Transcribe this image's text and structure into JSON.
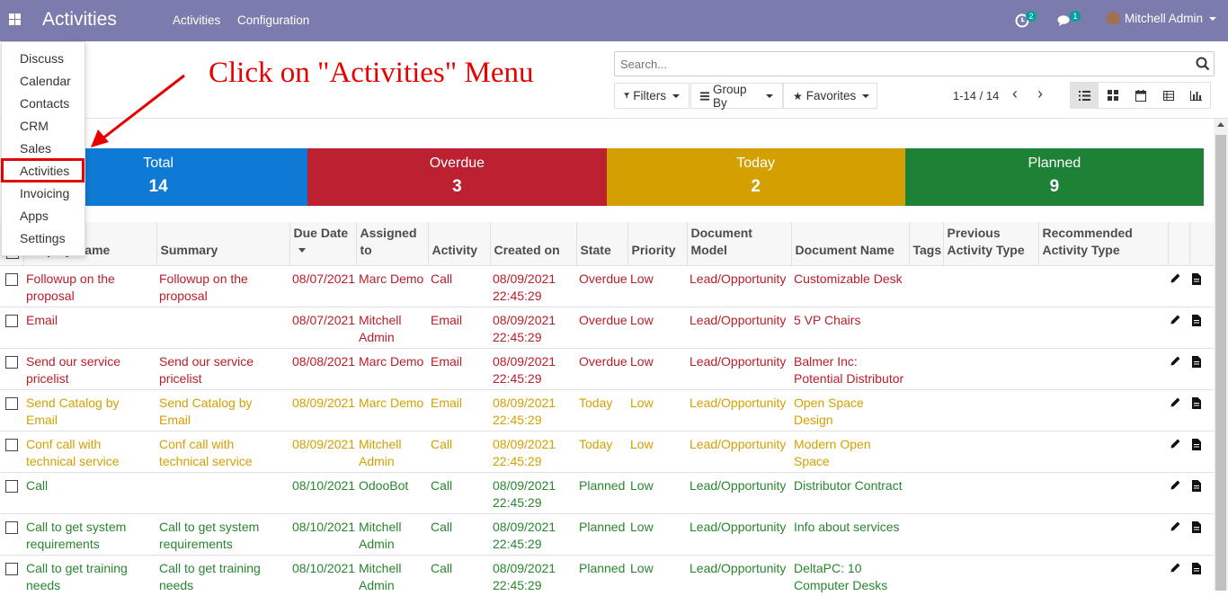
{
  "navbar": {
    "brand": "Activities",
    "menu": [
      "Activities",
      "Configuration"
    ],
    "activity_badge": "2",
    "message_badge": "1",
    "user_name": "Mitchell Admin",
    "bg_color": "#7c7bad"
  },
  "apps_menu": [
    "Discuss",
    "Calendar",
    "Contacts",
    "CRM",
    "Sales",
    "Activities",
    "Invoicing",
    "Apps",
    "Settings"
  ],
  "annotation": {
    "text": "Click on \"Activities\" Menu",
    "color": "#e60000"
  },
  "search": {
    "placeholder": "Search..."
  },
  "filters": {
    "filters": "Filters",
    "group_by": "Group By",
    "favorites": "Favorites"
  },
  "pager": {
    "value": "1-14 / 14"
  },
  "stats": [
    {
      "label": "Total",
      "value": "14",
      "color": "#0f7ad6"
    },
    {
      "label": "Overdue",
      "value": "3",
      "color": "#bb2130"
    },
    {
      "label": "Today",
      "value": "2",
      "color": "#d49f00"
    },
    {
      "label": "Planned",
      "value": "9",
      "color": "#1e8236"
    }
  ],
  "columns": {
    "display_name": "Display Name",
    "summary": "Summary",
    "due_date": "Due Date",
    "assigned_to": "Assigned to",
    "activity": "Activity",
    "created_on": "Created on",
    "state": "State",
    "priority": "Priority",
    "document_model": "Document Model",
    "document_name": "Document Name",
    "tags": "Tags",
    "previous_type": "Previous Activity Type",
    "recommended_type": "Recommended Activity Type"
  },
  "rows": [
    {
      "display_name": "Followup on the proposal",
      "summary": "Followup on the proposal",
      "due_date": "08/07/2021",
      "assigned_to": "Marc Demo",
      "activity": "Call",
      "created_on": "08/09/2021 22:45:29",
      "state": "Overdue",
      "priority": "Low",
      "document_model": "Lead/Opportunity",
      "document_name": "Customizable Desk",
      "status": "overdue"
    },
    {
      "display_name": "Email",
      "summary": "",
      "due_date": "08/07/2021",
      "assigned_to": "Mitchell Admin",
      "activity": "Email",
      "created_on": "08/09/2021 22:45:29",
      "state": "Overdue",
      "priority": "Low",
      "document_model": "Lead/Opportunity",
      "document_name": "5 VP Chairs",
      "status": "overdue"
    },
    {
      "display_name": "Send our service pricelist",
      "summary": "Send our service pricelist",
      "due_date": "08/08/2021",
      "assigned_to": "Marc Demo",
      "activity": "Email",
      "created_on": "08/09/2021 22:45:29",
      "state": "Overdue",
      "priority": "Low",
      "document_model": "Lead/Opportunity",
      "document_name": "Balmer Inc: Potential Distributor",
      "status": "overdue"
    },
    {
      "display_name": "Send Catalog by Email",
      "summary": "Send Catalog by Email",
      "due_date": "08/09/2021",
      "assigned_to": "Marc Demo",
      "activity": "Email",
      "created_on": "08/09/2021 22:45:29",
      "state": "Today",
      "priority": "Low",
      "document_model": "Lead/Opportunity",
      "document_name": "Open Space Design",
      "status": "today"
    },
    {
      "display_name": "Conf call with technical service",
      "summary": "Conf call with technical service",
      "due_date": "08/09/2021",
      "assigned_to": "Mitchell Admin",
      "activity": "Call",
      "created_on": "08/09/2021 22:45:29",
      "state": "Today",
      "priority": "Low",
      "document_model": "Lead/Opportunity",
      "document_name": "Modern Open Space",
      "status": "today"
    },
    {
      "display_name": "Call",
      "summary": "",
      "due_date": "08/10/2021",
      "assigned_to": "OdooBot",
      "activity": "Call",
      "created_on": "08/09/2021 22:45:29",
      "state": "Planned",
      "priority": "Low",
      "document_model": "Lead/Opportunity",
      "document_name": "Distributor Contract",
      "status": "planned"
    },
    {
      "display_name": "Call to get system requirements",
      "summary": "Call to get system requirements",
      "due_date": "08/10/2021",
      "assigned_to": "Mitchell Admin",
      "activity": "Call",
      "created_on": "08/09/2021 22:45:29",
      "state": "Planned",
      "priority": "Low",
      "document_model": "Lead/Opportunity",
      "document_name": "Info about services",
      "status": "planned"
    },
    {
      "display_name": "Call to get training needs",
      "summary": "Call to get training needs",
      "due_date": "08/10/2021",
      "assigned_to": "Mitchell Admin",
      "activity": "Call",
      "created_on": "08/09/2021 22:45:29",
      "state": "Planned",
      "priority": "Low",
      "document_model": "Lead/Opportunity",
      "document_name": "DeltaPC: 10 Computer Desks",
      "status": "planned"
    }
  ]
}
